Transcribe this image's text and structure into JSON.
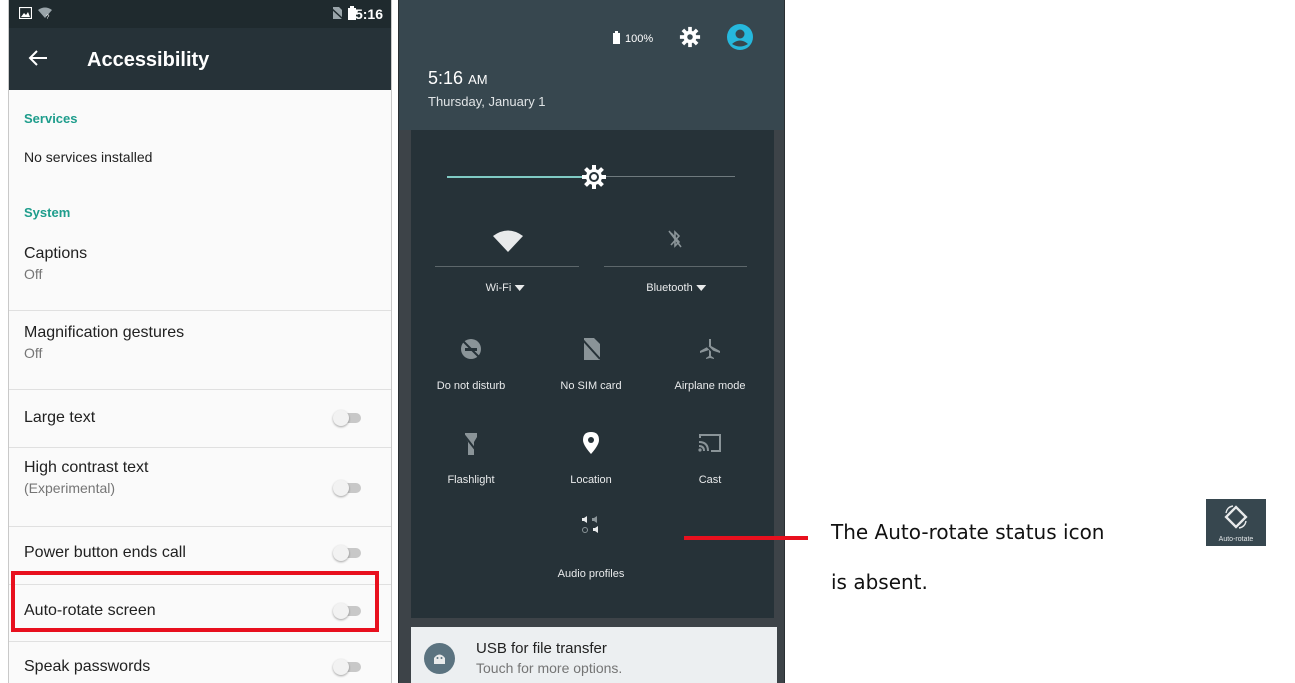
{
  "left_screen": {
    "status_bar": {
      "time": "5:16"
    },
    "app_bar": {
      "title": "Accessibility"
    },
    "services": {
      "header": "Services",
      "empty_text": "No services installed"
    },
    "system": {
      "header": "System",
      "items": [
        {
          "title": "Captions",
          "subtitle": "Off"
        },
        {
          "title": "Magnification gestures",
          "subtitle": "Off"
        },
        {
          "title": "Large text",
          "toggle_on": false
        },
        {
          "title": "High contrast text",
          "subtitle": "(Experimental)",
          "toggle_on": false
        },
        {
          "title": "Power button ends call",
          "toggle_on": false
        },
        {
          "title": "Auto-rotate screen",
          "toggle_on": false,
          "highlighted": true
        },
        {
          "title": "Speak passwords",
          "toggle_on": false
        }
      ]
    }
  },
  "right_screen": {
    "header": {
      "battery": "100%",
      "time": "5:16",
      "ampm": "AM",
      "date": "Thursday, January 1"
    },
    "brightness_level": 0.5,
    "tiles": {
      "wifi": "Wi-Fi",
      "bluetooth": "Bluetooth",
      "dnd": "Do not disturb",
      "sim": "No SIM card",
      "airplane": "Airplane mode",
      "flashlight": "Flashlight",
      "location": "Location",
      "cast": "Cast",
      "audio": "Audio profiles"
    },
    "notification": {
      "title": "USB for file transfer",
      "subtitle": "Touch for more options."
    }
  },
  "annotation": {
    "line1": "The Auto-rotate status icon",
    "line2": "is absent.",
    "example_label": "Auto-rotate"
  },
  "colors": {
    "accent": "#1e9d8c",
    "highlight": "#e8101e",
    "qs_panel": "#263238",
    "app_bar": "#263238"
  }
}
